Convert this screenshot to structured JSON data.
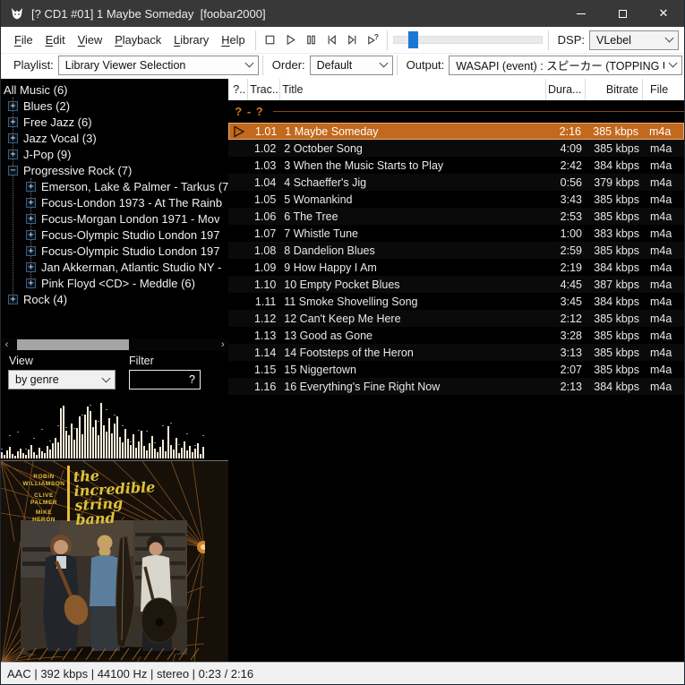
{
  "window": {
    "title": "[? CD1 #01] 1 Maybe Someday  [foobar2000]",
    "close_glyph": "✕"
  },
  "menubar": {
    "items": [
      "File",
      "Edit",
      "View",
      "Playback",
      "Library",
      "Help"
    ]
  },
  "transport": {
    "buttons": [
      "stop",
      "play",
      "pause",
      "previous",
      "next",
      "random"
    ]
  },
  "seek": {
    "position_pct": 13
  },
  "dsp": {
    "label": "DSP:",
    "value": "VLebel"
  },
  "selectors": {
    "playlist_label": "Playlist:",
    "playlist_value": "Library Viewer Selection",
    "order_label": "Order:",
    "order_value": "Default",
    "output_label": "Output:",
    "output_value": "WASAPI (event) : スピーカー (TOPPING USB DAC"
  },
  "tree": {
    "items": [
      {
        "label": "All Music (6)",
        "level": 0,
        "expander": "none"
      },
      {
        "label": "Blues (2)",
        "level": 1,
        "expander": "plus"
      },
      {
        "label": "Free Jazz (6)",
        "level": 1,
        "expander": "plus"
      },
      {
        "label": "Jazz Vocal (3)",
        "level": 1,
        "expander": "plus"
      },
      {
        "label": "J-Pop (9)",
        "level": 1,
        "expander": "plus"
      },
      {
        "label": "Progressive Rock (7)",
        "level": 1,
        "expander": "minus"
      },
      {
        "label": "Emerson, Lake & Palmer - Tarkus (7",
        "level": 2,
        "expander": "plus"
      },
      {
        "label": "Focus-London 1973 - At The Rainb",
        "level": 2,
        "expander": "plus"
      },
      {
        "label": "Focus-Morgan London 1971 - Mov",
        "level": 2,
        "expander": "plus"
      },
      {
        "label": "Focus-Olympic Studio London 197",
        "level": 2,
        "expander": "plus"
      },
      {
        "label": "Focus-Olympic Studio London 197",
        "level": 2,
        "expander": "plus"
      },
      {
        "label": "Jan Akkerman, Atlantic Studio NY -",
        "level": 2,
        "expander": "plus"
      },
      {
        "label": "Pink Floyd <CD> - Meddle (6)",
        "level": 2,
        "expander": "plus"
      },
      {
        "label": "Rock (4)",
        "level": 1,
        "expander": "plus"
      }
    ],
    "scroll_left": "‹",
    "scroll_right": "›",
    "view_label": "View",
    "view_value": "by genre",
    "filter_label": "Filter",
    "filter_glyph": "?"
  },
  "spectrum": {
    "bars": [
      7,
      4,
      9,
      13,
      5,
      3,
      8,
      11,
      6,
      4,
      10,
      15,
      7,
      4,
      12,
      8,
      6,
      14,
      10,
      17,
      23,
      18,
      56,
      59,
      31,
      26,
      39,
      21,
      34,
      47,
      27,
      49,
      58,
      53,
      35,
      43,
      26,
      62,
      37,
      30,
      45,
      28,
      39,
      47,
      24,
      18,
      33,
      22,
      15,
      27,
      12,
      19,
      31,
      14,
      9,
      17,
      25,
      11,
      7,
      13,
      21,
      8,
      36,
      15,
      10,
      23,
      6,
      12,
      19,
      9,
      14,
      7,
      11,
      17,
      5,
      13
    ]
  },
  "album": {
    "artist_lines": [
      "ROBIN",
      "WILLIAMSON",
      "CLIVE",
      "PALMER",
      "MIKE",
      "HERON"
    ],
    "title_lines": [
      "the",
      "incredible",
      "string",
      "band"
    ]
  },
  "playlist": {
    "columns": [
      "?..",
      "Trac...",
      "Title",
      "Dura...",
      "Bitrate",
      "File"
    ],
    "group_label": "? - ?",
    "rows": [
      {
        "track": "1.01",
        "title": "1 Maybe Someday",
        "duration": "2:16",
        "bitrate": "385 kbps",
        "file": "m4a",
        "playing": true
      },
      {
        "track": "1.02",
        "title": "2 October Song",
        "duration": "4:09",
        "bitrate": "385 kbps",
        "file": "m4a",
        "playing": false
      },
      {
        "track": "1.03",
        "title": "3 When the Music Starts to Play",
        "duration": "2:42",
        "bitrate": "384 kbps",
        "file": "m4a",
        "playing": false
      },
      {
        "track": "1.04",
        "title": "4 Schaeffer's Jig",
        "duration": "0:56",
        "bitrate": "379 kbps",
        "file": "m4a",
        "playing": false
      },
      {
        "track": "1.05",
        "title": "5 Womankind",
        "duration": "3:43",
        "bitrate": "385 kbps",
        "file": "m4a",
        "playing": false
      },
      {
        "track": "1.06",
        "title": "6 The Tree",
        "duration": "2:53",
        "bitrate": "385 kbps",
        "file": "m4a",
        "playing": false
      },
      {
        "track": "1.07",
        "title": "7 Whistle Tune",
        "duration": "1:00",
        "bitrate": "383 kbps",
        "file": "m4a",
        "playing": false
      },
      {
        "track": "1.08",
        "title": "8 Dandelion Blues",
        "duration": "2:59",
        "bitrate": "385 kbps",
        "file": "m4a",
        "playing": false
      },
      {
        "track": "1.09",
        "title": "9 How Happy I Am",
        "duration": "2:19",
        "bitrate": "384 kbps",
        "file": "m4a",
        "playing": false
      },
      {
        "track": "1.10",
        "title": "10 Empty Pocket Blues",
        "duration": "4:45",
        "bitrate": "387 kbps",
        "file": "m4a",
        "playing": false
      },
      {
        "track": "1.11",
        "title": "11 Smoke Shovelling Song",
        "duration": "3:45",
        "bitrate": "384 kbps",
        "file": "m4a",
        "playing": false
      },
      {
        "track": "1.12",
        "title": "12 Can't Keep Me Here",
        "duration": "2:12",
        "bitrate": "385 kbps",
        "file": "m4a",
        "playing": false
      },
      {
        "track": "1.13",
        "title": "13 Good as Gone",
        "duration": "3:28",
        "bitrate": "385 kbps",
        "file": "m4a",
        "playing": false
      },
      {
        "track": "1.14",
        "title": "14 Footsteps of the Heron",
        "duration": "3:13",
        "bitrate": "385 kbps",
        "file": "m4a",
        "playing": false
      },
      {
        "track": "1.15",
        "title": "15 Niggertown",
        "duration": "2:07",
        "bitrate": "385 kbps",
        "file": "m4a",
        "playing": false
      },
      {
        "track": "1.16",
        "title": "16 Everything's Fine Right Now",
        "duration": "2:13",
        "bitrate": "384 kbps",
        "file": "m4a",
        "playing": false
      }
    ]
  },
  "status": {
    "text": "AAC | 392 kbps | 44100 Hz | stereo | 0:23 / 2:16"
  },
  "colors": {
    "accent": "#c2691d",
    "group_text": "#cf7a1e",
    "seek_thumb": "#1a78d4"
  }
}
